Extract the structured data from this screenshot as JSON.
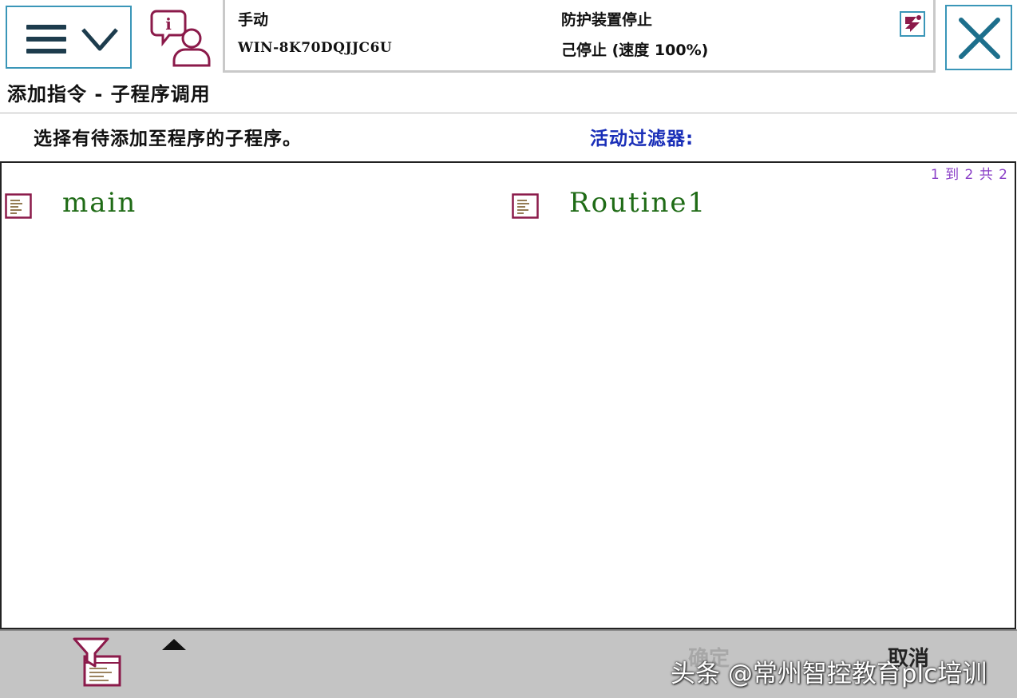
{
  "header": {
    "menu_icon": "hamburger-chevron-icon",
    "event_log_icon": "info-person-icon",
    "status": {
      "mode": "手动",
      "system_name": "WIN-8K70DQJJC6U",
      "safety": "防护装置停止",
      "run_state": "己停止 (速度 100%)"
    },
    "robot_icon": "robot-status-icon",
    "close_icon": "close-icon"
  },
  "title": "添加指令 - 子程序调用",
  "instruction": "选择有待添加至程序的子程序。",
  "filter_label": "活动过滤器:",
  "list": {
    "page_info": "1 到 2 共 2",
    "items": [
      {
        "name": "main",
        "icon": "routine-document-icon"
      },
      {
        "name": "Routine1",
        "icon": "routine-document-icon"
      }
    ]
  },
  "footer": {
    "filter_icon": "filter-funnel-icon",
    "scroll_up_icon": "scroll-up-arrow-icon",
    "confirm_label": "确定",
    "cancel_label": "取消",
    "watermark": "头条 @常州智控教育plc培训"
  },
  "colors": {
    "accent_border": "#3a96b8",
    "routine_text": "#1f6b16",
    "filter_label": "#1a2fb8",
    "page_info": "#8a3fc7",
    "icon_maroon": "#8b1a4a"
  }
}
